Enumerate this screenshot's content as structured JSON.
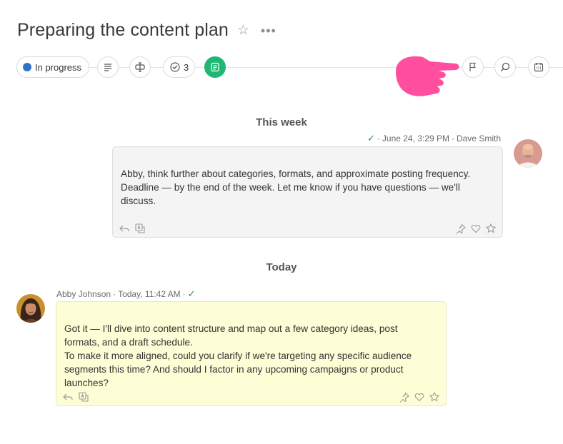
{
  "header": {
    "title": "Preparing the content plan"
  },
  "toolbar": {
    "status_label": "In progress",
    "status_color": "#2e73c6",
    "checklist_count": "3",
    "chat_active_color": "#1fb873"
  },
  "feed": {
    "sections": [
      {
        "heading": "This week",
        "message": {
          "date": "June 24, 3:29 PM",
          "author": "Dave Smith",
          "text": "Abby, think further about categories, formats, and approximate posting frequency. Deadline — by the end of the week. Let me know if you have questions — we'll discuss.",
          "bubble_color": "#f4f4f4"
        }
      },
      {
        "heading": "Today",
        "message": {
          "author": "Abby Johnson",
          "date": "Today, 11:42 AM",
          "text_line1": "Got it — I'll dive into content structure and map out a few category ideas, post formats, and a draft schedule.",
          "text_line2": "To make it more aligned, could you clarify if we're targeting any specific audience segments this time? And should I factor in any upcoming campaigns or product launches?",
          "bubble_color": "#fdfdd6"
        }
      }
    ]
  }
}
